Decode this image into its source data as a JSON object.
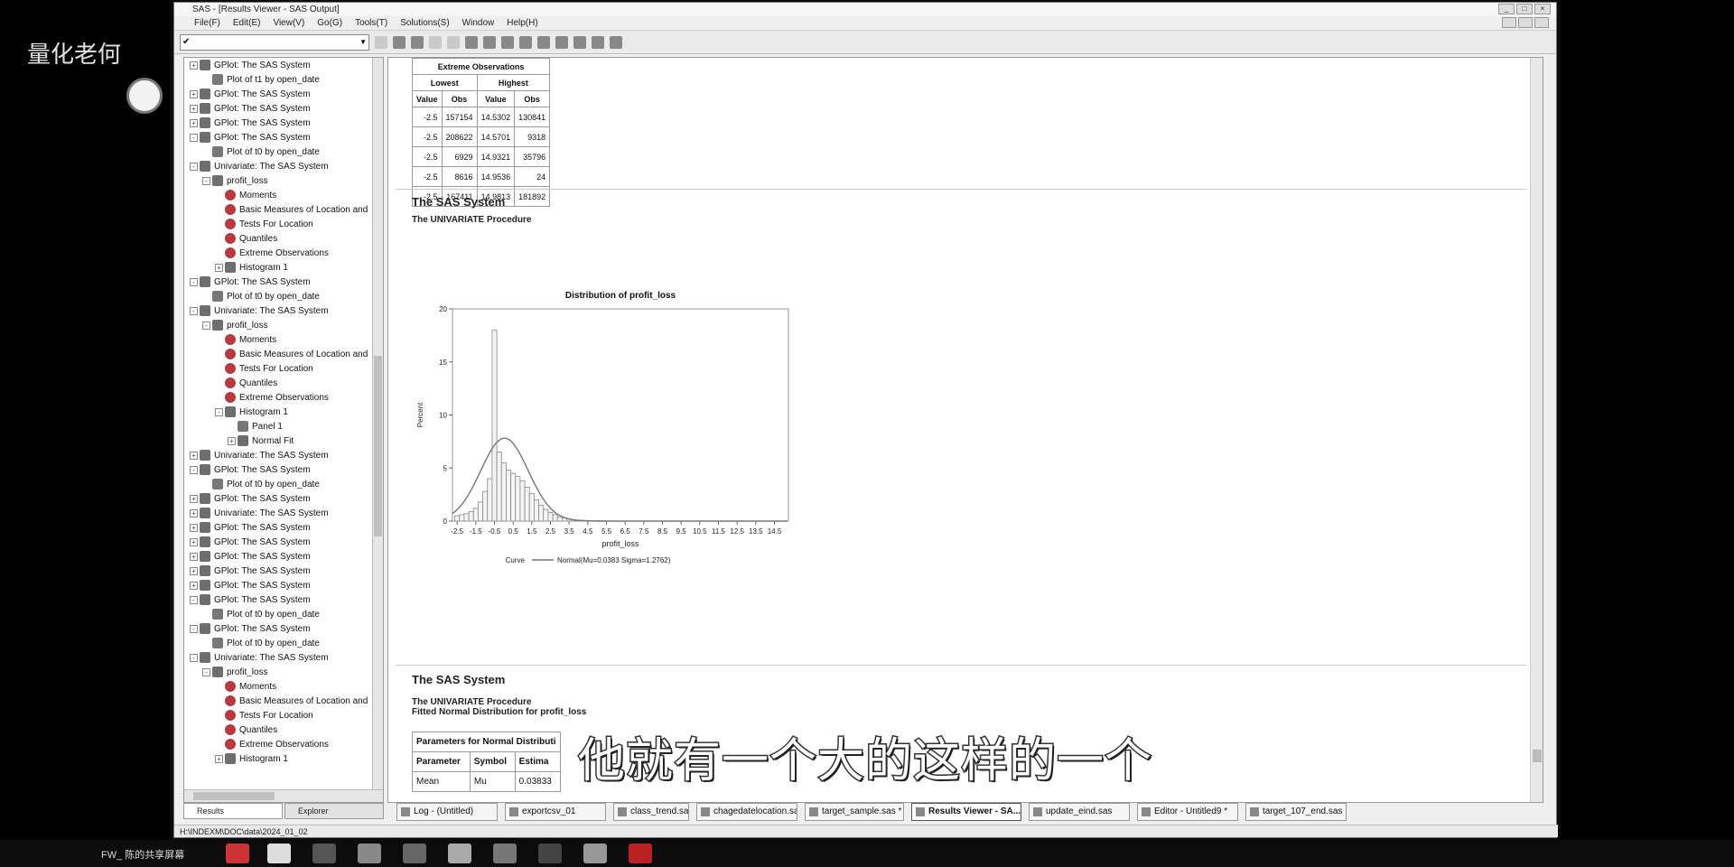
{
  "app": {
    "title": "SAS - [Results Viewer - SAS Output]",
    "menu": [
      "File(F)",
      "Edit(E)",
      "View(V)",
      "Go(G)",
      "Tools(T)",
      "Solutions(S)",
      "Window",
      "Help(H)"
    ],
    "command_value": ""
  },
  "watermark": {
    "text": "量化老何"
  },
  "tree": [
    {
      "level": 0,
      "exp": "+",
      "icon": "folder",
      "label": "GPlot:  The SAS System"
    },
    {
      "level": 1,
      "exp": "",
      "icon": "doc",
      "label": "Plot of t1 by open_date"
    },
    {
      "level": 0,
      "exp": "+",
      "icon": "folder",
      "label": "GPlot:  The SAS System"
    },
    {
      "level": 0,
      "exp": "+",
      "icon": "folder",
      "label": "GPlot:  The SAS System"
    },
    {
      "level": 0,
      "exp": "+",
      "icon": "folder",
      "label": "GPlot:  The SAS System"
    },
    {
      "level": 0,
      "exp": "-",
      "icon": "folder",
      "label": "GPlot:  The SAS System"
    },
    {
      "level": 1,
      "exp": "",
      "icon": "doc",
      "label": "Plot of t0 by open_date"
    },
    {
      "level": 0,
      "exp": "-",
      "icon": "folder",
      "label": "Univariate:  The SAS System"
    },
    {
      "level": 1,
      "exp": "-",
      "icon": "folder",
      "label": "profit_loss"
    },
    {
      "level": 2,
      "exp": "",
      "icon": "red",
      "label": "Moments"
    },
    {
      "level": 2,
      "exp": "",
      "icon": "red",
      "label": "Basic Measures of Location and"
    },
    {
      "level": 2,
      "exp": "",
      "icon": "red",
      "label": "Tests For Location"
    },
    {
      "level": 2,
      "exp": "",
      "icon": "red",
      "label": "Quantiles"
    },
    {
      "level": 2,
      "exp": "",
      "icon": "red",
      "label": "Extreme Observations"
    },
    {
      "level": 2,
      "exp": "+",
      "icon": "folder",
      "label": "Histogram 1"
    },
    {
      "level": 0,
      "exp": "-",
      "icon": "folder",
      "label": "GPlot:  The SAS System"
    },
    {
      "level": 1,
      "exp": "",
      "icon": "doc",
      "label": "Plot of t0 by open_date"
    },
    {
      "level": 0,
      "exp": "-",
      "icon": "folder",
      "label": "Univariate:  The SAS System"
    },
    {
      "level": 1,
      "exp": "-",
      "icon": "folder",
      "label": "profit_loss"
    },
    {
      "level": 2,
      "exp": "",
      "icon": "red",
      "label": "Moments"
    },
    {
      "level": 2,
      "exp": "",
      "icon": "red",
      "label": "Basic Measures of Location and"
    },
    {
      "level": 2,
      "exp": "",
      "icon": "red",
      "label": "Tests For Location"
    },
    {
      "level": 2,
      "exp": "",
      "icon": "red",
      "label": "Quantiles"
    },
    {
      "level": 2,
      "exp": "",
      "icon": "red",
      "label": "Extreme Observations"
    },
    {
      "level": 2,
      "exp": "-",
      "icon": "folder",
      "label": "Histogram 1"
    },
    {
      "level": 3,
      "exp": "",
      "icon": "doc",
      "label": "Panel 1"
    },
    {
      "level": 3,
      "exp": "+",
      "icon": "folder",
      "label": "Normal Fit"
    },
    {
      "level": 0,
      "exp": "+",
      "icon": "folder",
      "label": "Univariate:  The SAS System"
    },
    {
      "level": 0,
      "exp": "-",
      "icon": "folder",
      "label": "GPlot:  The SAS System"
    },
    {
      "level": 1,
      "exp": "",
      "icon": "doc",
      "label": "Plot of t0 by open_date"
    },
    {
      "level": 0,
      "exp": "+",
      "icon": "folder",
      "label": "GPlot:  The SAS System"
    },
    {
      "level": 0,
      "exp": "+",
      "icon": "folder",
      "label": "Univariate:  The SAS System"
    },
    {
      "level": 0,
      "exp": "+",
      "icon": "folder",
      "label": "GPlot:  The SAS System"
    },
    {
      "level": 0,
      "exp": "+",
      "icon": "folder",
      "label": "GPlot:  The SAS System"
    },
    {
      "level": 0,
      "exp": "+",
      "icon": "folder",
      "label": "GPlot:  The SAS System"
    },
    {
      "level": 0,
      "exp": "+",
      "icon": "folder",
      "label": "GPlot:  The SAS System"
    },
    {
      "level": 0,
      "exp": "+",
      "icon": "folder",
      "label": "GPlot:  The SAS System"
    },
    {
      "level": 0,
      "exp": "-",
      "icon": "folder",
      "label": "GPlot:  The SAS System"
    },
    {
      "level": 1,
      "exp": "",
      "icon": "doc",
      "label": "Plot of t0 by open_date"
    },
    {
      "level": 0,
      "exp": "-",
      "icon": "folder",
      "label": "GPlot:  The SAS System"
    },
    {
      "level": 1,
      "exp": "",
      "icon": "doc",
      "label": "Plot of t0 by open_date"
    },
    {
      "level": 0,
      "exp": "-",
      "icon": "folder",
      "label": "Univariate:  The SAS System"
    },
    {
      "level": 1,
      "exp": "-",
      "icon": "folder",
      "label": "profit_loss"
    },
    {
      "level": 2,
      "exp": "",
      "icon": "red",
      "label": "Moments"
    },
    {
      "level": 2,
      "exp": "",
      "icon": "red",
      "label": "Basic Measures of Location and"
    },
    {
      "level": 2,
      "exp": "",
      "icon": "red",
      "label": "Tests For Location"
    },
    {
      "level": 2,
      "exp": "",
      "icon": "red",
      "label": "Quantiles"
    },
    {
      "level": 2,
      "exp": "",
      "icon": "red",
      "label": "Extreme Observations"
    },
    {
      "level": 2,
      "exp": "+",
      "icon": "folder",
      "label": "Histogram 1"
    }
  ],
  "left_tabs": [
    "Results",
    "Explorer"
  ],
  "extreme": {
    "title": "Extreme Observations",
    "lowest": "Lowest",
    "highest": "Highest",
    "cols": [
      "Value",
      "Obs",
      "Value",
      "Obs"
    ],
    "rows": [
      [
        "-2.5",
        "157154",
        "14.5302",
        "130841"
      ],
      [
        "-2.5",
        "208622",
        "14.5701",
        "9318"
      ],
      [
        "-2.5",
        "6929",
        "14.9321",
        "35796"
      ],
      [
        "-2.5",
        "8616",
        "14.9536",
        "24"
      ],
      [
        "-2.5",
        "167411",
        "14.9813",
        "181892"
      ]
    ]
  },
  "section1": {
    "system": "The SAS System",
    "proc": "The UNIVARIATE Procedure"
  },
  "section2": {
    "system": "The SAS System",
    "proc": "The UNIVARIATE Procedure",
    "sub": "Fitted Normal Distribution for profit_loss"
  },
  "params": {
    "caption": "Parameters for Normal Distributi",
    "cols": [
      "Parameter",
      "Symbol",
      "Estima"
    ],
    "rows": [
      [
        "Mean",
        "Mu",
        "0.03833"
      ]
    ]
  },
  "chart_data": {
    "type": "bar",
    "title": "Distribution of profit_loss",
    "xlabel": "profit_loss",
    "ylabel": "Percent",
    "xlim": [
      -2.75,
      15.25
    ],
    "ylim": [
      0,
      20
    ],
    "x_ticks": [
      "-2.5",
      "-1.5",
      "-0.5",
      "0.5",
      "1.5",
      "2.5",
      "3.5",
      "4.5",
      "5.5",
      "6.5",
      "7.5",
      "8.5",
      "9.5",
      "10.5",
      "11.5",
      "12.5",
      "13.5",
      "14.5"
    ],
    "y_ticks": [
      "0",
      "5",
      "10",
      "15",
      "20"
    ],
    "bin_width": 0.25,
    "bins_center": [
      -2.5,
      -2.25,
      -2.0,
      -1.75,
      -1.5,
      -1.25,
      -1.0,
      -0.75,
      -0.5,
      -0.25,
      0.0,
      0.25,
      0.5,
      0.75,
      1.0,
      1.25,
      1.5,
      1.75,
      2.0,
      2.25,
      2.5,
      2.75,
      3.0,
      3.25,
      3.5,
      3.75,
      4.0,
      4.25,
      4.5,
      4.75,
      5.0,
      5.25,
      5.5
    ],
    "values": [
      0.5,
      0.6,
      0.7,
      0.9,
      1.2,
      1.8,
      2.8,
      4.0,
      18.0,
      6.5,
      5.5,
      4.8,
      4.5,
      4.2,
      3.8,
      3.2,
      2.6,
      2.0,
      1.5,
      1.1,
      0.8,
      0.6,
      0.4,
      0.3,
      0.2,
      0.15,
      0.1,
      0.08,
      0.06,
      0.05,
      0.04,
      0.03,
      0.02
    ],
    "curve": {
      "name": "Normal(Mu=0.0383 Sigma=1.2762)",
      "mu": 0.0383,
      "sigma": 1.2762
    },
    "legend_label": "Curve",
    "legend_text": "Normal(Mu=0.0383 Sigma=1.2762)"
  },
  "tasks": [
    {
      "label": "Log - (Untitled)",
      "active": false
    },
    {
      "label": "exportcsv_01",
      "active": false
    },
    {
      "label": "class_trend.sas",
      "active": false
    },
    {
      "label": "chagedatelocation.sas",
      "active": false
    },
    {
      "label": "target_sample.sas *",
      "active": false
    },
    {
      "label": "Results Viewer - SA...",
      "active": true
    },
    {
      "label": "update_eind.sas",
      "active": false
    },
    {
      "label": "Editor - Untitled9 *",
      "active": false
    },
    {
      "label": "target_107_end.sas",
      "active": false
    }
  ],
  "status": {
    "path": "H:\\INDEXM\\DOC\\data\\2024_01_02"
  },
  "subtitle": "他就有一个大的这样的一个",
  "wintaskbar": {
    "label": "FW_ 陈的共享屏幕"
  }
}
